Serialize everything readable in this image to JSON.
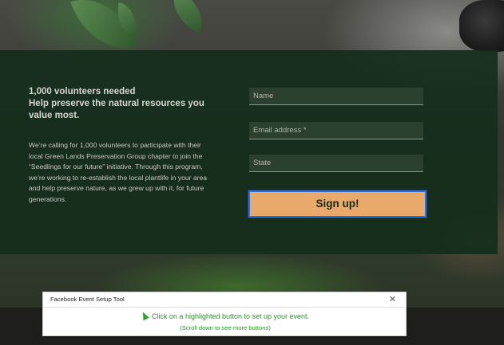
{
  "hero": {
    "headline_line1": "1,000 volunteers needed",
    "headline_line2": "Help preserve the natural resources you value most.",
    "body": "We’re calling for 1,000 volunteers to participate with their local Green Lands Preservation Group chapter to join the “Seedlings for our future” initiative. Through this program, we’re working to re-establish the local plantlife in your area and help preserve nature, as we grew up with it, for future generations."
  },
  "form": {
    "name_placeholder": "Name",
    "email_placeholder": "Email address *",
    "state_placeholder": "State",
    "submit_label": "Sign up!"
  },
  "tool": {
    "title": "Facebook Event Setup Tool",
    "close_icon": "close-icon",
    "message": "Click on a highlighted button to set up your event.",
    "sub_message": "(Scroll down to see more buttons)"
  },
  "colors": {
    "panel": "#162d1c",
    "button": "#e9a96b",
    "highlight_border": "#2f6fd0",
    "tool_text": "#1d9a1d"
  }
}
